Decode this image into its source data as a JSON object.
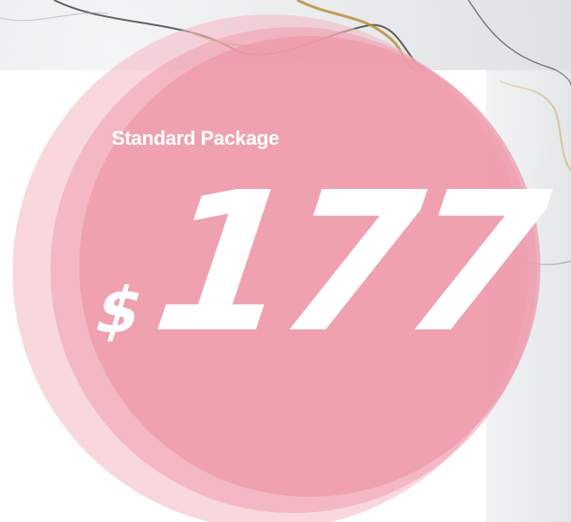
{
  "card": {
    "title": "Standard Package",
    "currency_symbol": "$",
    "price": "177"
  },
  "colors": {
    "circle_fill": "#ee9aa9",
    "circle_outer": "#f2b6c1",
    "text": "#ffffff",
    "marble_vein": "#b8913a"
  }
}
